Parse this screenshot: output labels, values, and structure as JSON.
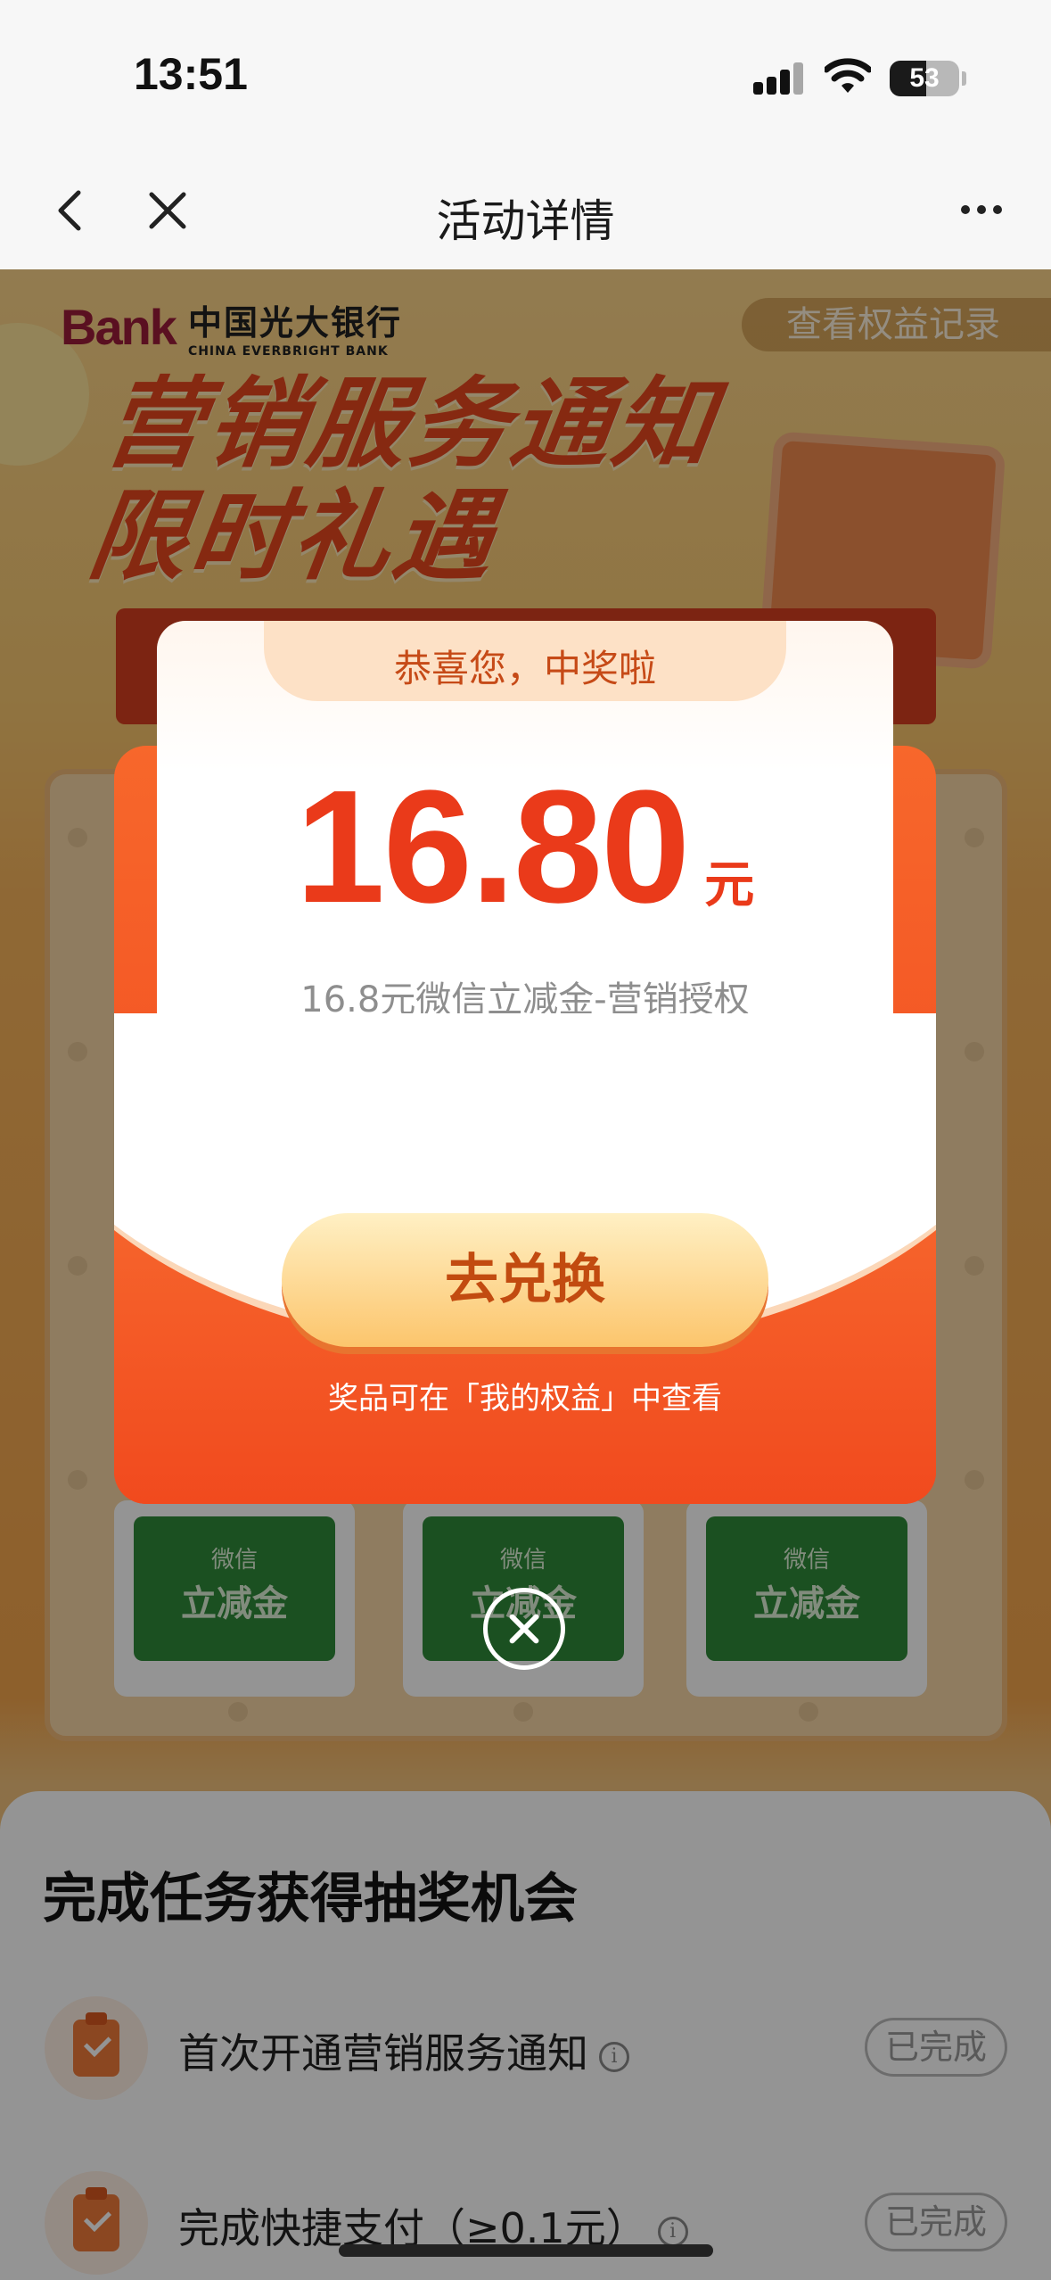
{
  "status_bar": {
    "time": "13:51",
    "battery": "53",
    "battery_level": 0.53
  },
  "nav": {
    "title": "活动详情"
  },
  "bank": {
    "logo_mark": "Bank",
    "name_cn": "中国光大银行",
    "name_en": "CHINA EVERBRIGHT BANK"
  },
  "page": {
    "rights_record_label": "查看权益记录",
    "headline_line1": "营销服务通知",
    "headline_line2": "限时礼遇"
  },
  "prize_tiles": [
    {
      "small": "微信",
      "big": "立减金"
    },
    {
      "small": "微信",
      "big": "立减金"
    },
    {
      "small": "微信",
      "big": "立减金"
    }
  ],
  "modal": {
    "congrats": "恭喜您，中奖啦",
    "amount": "16.80",
    "unit": "元",
    "description": "16.8元微信立减金-营销授权",
    "redeem_button": "去兑换",
    "hint": "奖品可在「我的权益」中查看"
  },
  "tasks": {
    "title": "完成任务获得抽奖机会",
    "items": [
      {
        "label": "首次开通营销服务通知",
        "status": "已完成"
      },
      {
        "label": "完成快捷支付（≥0.1元）",
        "status": "已完成"
      }
    ]
  },
  "colors": {
    "accent": "#ea3a1a",
    "envelope": "#f25a24",
    "button": "#fcc56c"
  }
}
